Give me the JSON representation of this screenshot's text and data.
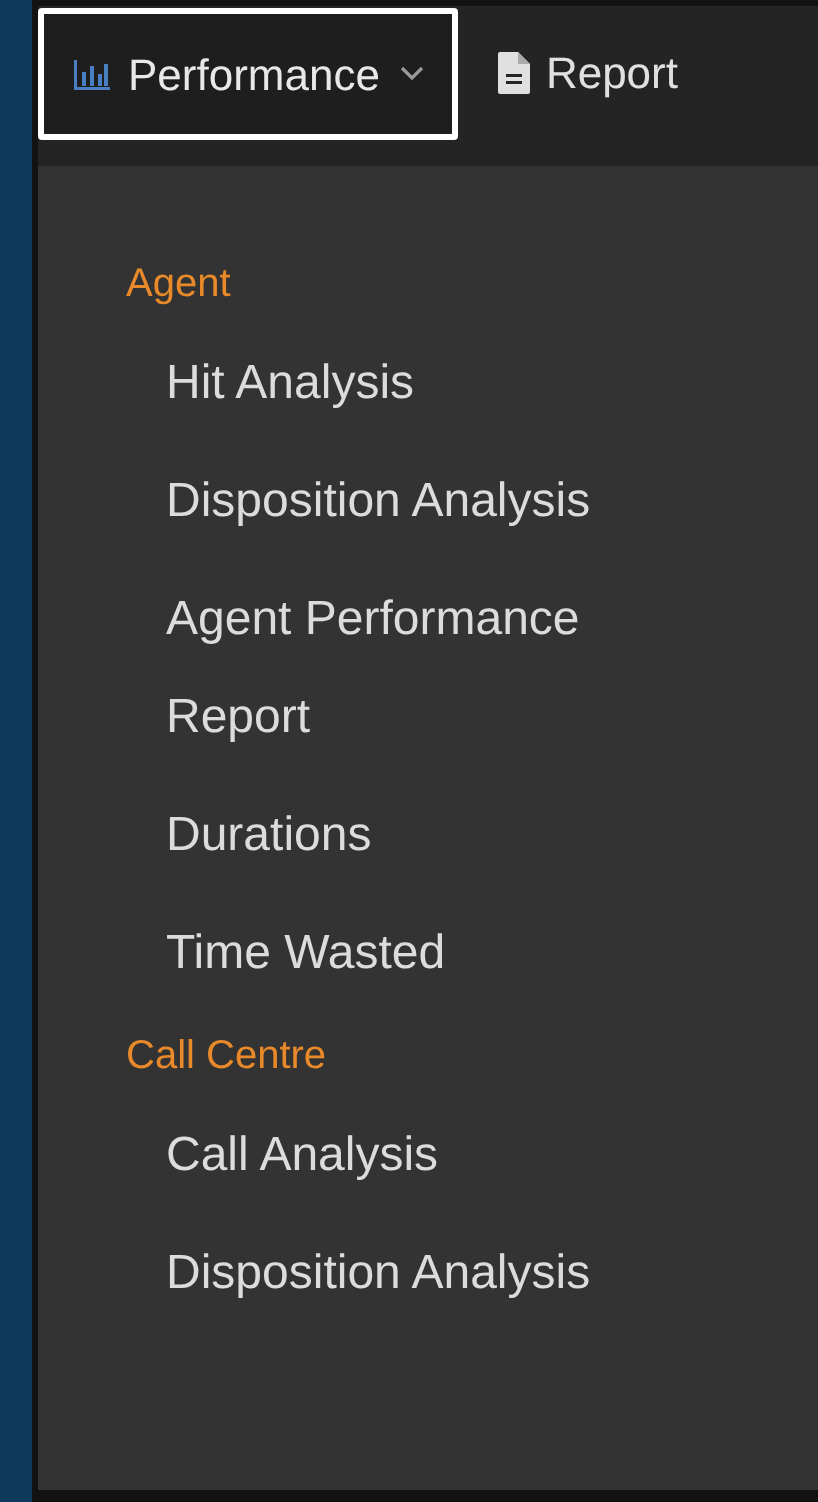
{
  "nav": {
    "tabs": [
      {
        "label": "Performance",
        "kind": "chart",
        "selected": true,
        "dropdown": true
      },
      {
        "label": "Report",
        "kind": "document",
        "selected": false,
        "dropdown": false
      }
    ]
  },
  "menu": {
    "groups": [
      {
        "title": "Agent",
        "items": [
          "Hit Analysis",
          "Disposition Analysis",
          "Agent Performance Report",
          "Durations",
          "Time Wasted"
        ]
      },
      {
        "title": "Call Centre",
        "items": [
          "Call Analysis",
          "Disposition Analysis"
        ]
      }
    ]
  }
}
